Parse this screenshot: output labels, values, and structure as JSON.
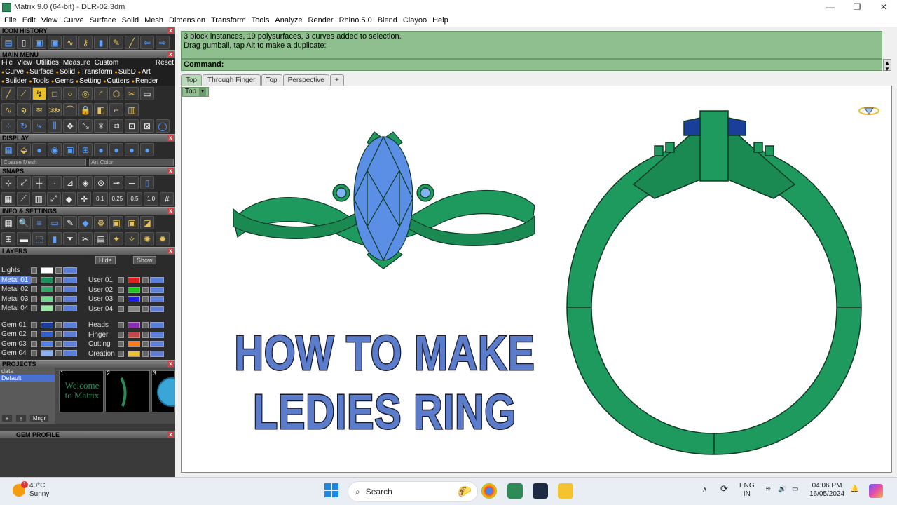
{
  "window": {
    "title": "Matrix 9.0 (64-bit) - DLR-02.3dm",
    "minimize": "—",
    "maximize": "❐",
    "close": "✕"
  },
  "menu": [
    "File",
    "Edit",
    "View",
    "Curve",
    "Surface",
    "Solid",
    "Mesh",
    "Dimension",
    "Transform",
    "Tools",
    "Analyze",
    "Render",
    "Rhino 5.0",
    "Blend",
    "Clayoo",
    "Help"
  ],
  "panels": {
    "icon_history": "ICON HISTORY",
    "main_menu": "MAIN MENU",
    "main_menu_items": [
      "File",
      "View",
      "Utilities",
      "Measure",
      "Custom"
    ],
    "reset": "Reset",
    "categories_row1": [
      "Curve",
      "Surface",
      "Solid",
      "Transform",
      "SubD",
      "Art"
    ],
    "categories_row2": [
      "Builder",
      "Tools",
      "Gems",
      "Setting",
      "Cutters",
      "Render"
    ],
    "display": "DISPLAY",
    "display_mesh": "Coarse Mesh",
    "display_color": "Art Color",
    "snaps": "SNAPS",
    "snap_values": [
      "0.1",
      "0.25",
      "0.5",
      "1.0"
    ],
    "info_settings": "INFO & SETTINGS",
    "layers": "LAYERS",
    "projects": "PROJECTS",
    "gem_profile": "GEM PROFILE",
    "close_x": "x"
  },
  "layers": {
    "hide": "Hide",
    "show": "Show",
    "left": [
      {
        "name": "Lights",
        "color": "#ffffff"
      },
      {
        "name": "Metal 01",
        "color": "#1e8f5a",
        "selected": true
      },
      {
        "name": "Metal 02",
        "color": "#2fa86a"
      },
      {
        "name": "Metal 03",
        "color": "#6fd88f"
      },
      {
        "name": "Metal 04",
        "color": "#9ae6a8"
      },
      {
        "name": "Gem 01",
        "color": "#1a3f9a"
      },
      {
        "name": "Gem 02",
        "color": "#2f5fcf"
      },
      {
        "name": "Gem 03",
        "color": "#4f7fe6"
      },
      {
        "name": "Gem 04",
        "color": "#8fb0f0"
      }
    ],
    "right": [
      {
        "name": "User 01",
        "color": "#e02020"
      },
      {
        "name": "User 02",
        "color": "#20c020"
      },
      {
        "name": "User 03",
        "color": "#2020e0"
      },
      {
        "name": "User 04",
        "color": "#888888"
      },
      {
        "name": "Heads",
        "color": "#8a2fb0"
      },
      {
        "name": "Finger",
        "color": "#c04a4a"
      },
      {
        "name": "Cutting",
        "color": "#ff7a1a"
      },
      {
        "name": "Creation",
        "color": "#f0c030"
      }
    ]
  },
  "projects": {
    "list": [
      "data",
      "Default"
    ],
    "thumbs": [
      "1",
      "2",
      "3"
    ],
    "thumb_text": "Welcome to Matrix",
    "mngr": "Mngr"
  },
  "command": {
    "history_line1": "3 block instances, 19 polysurfaces, 3 curves added to selection.",
    "history_line2": "Drag gumball, tap Alt to make a duplicate:",
    "prompt": "Command:"
  },
  "tabs": [
    "Top",
    "Through Finger",
    "Top",
    "Perspective",
    "+"
  ],
  "viewport": {
    "label": "Top",
    "dropdown": "▼"
  },
  "overlay": {
    "line1": "HOW TO MAKE",
    "line2": "LEDIES RING"
  },
  "colors": {
    "metal": "#1f9a5e",
    "gem": "#5b8fe6",
    "headline": "#5a7ccb",
    "command_bg": "#8fbf8f"
  },
  "taskbar": {
    "temperature": "40°C",
    "weather": "Sunny",
    "badge": "1",
    "search": "Search",
    "lang1": "ENG",
    "lang2": "IN",
    "time": "04:06 PM",
    "date": "16/05/2024"
  }
}
